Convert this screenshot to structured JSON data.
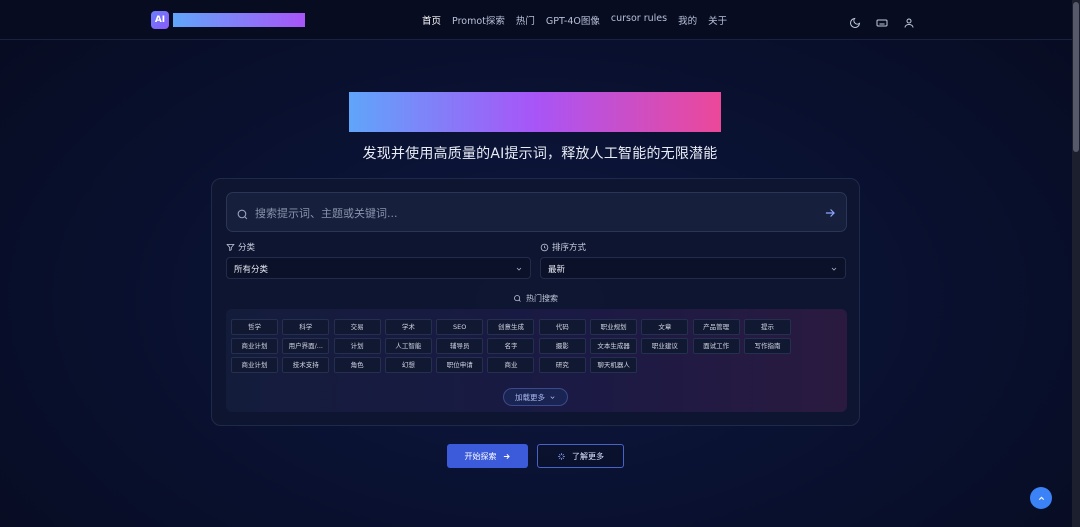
{
  "header": {
    "logo_text": "AI",
    "nav": [
      "首页",
      "Promot探索",
      "热门",
      "GPT-4O图像",
      "cursor rules",
      "我的",
      "关于"
    ],
    "icons": [
      "moon-icon",
      "keyboard-icon",
      "user-icon"
    ]
  },
  "hero": {
    "subtitle": "发现并使用高质量的AI提示词，释放人工智能的无限潜能"
  },
  "search": {
    "placeholder": "搜索提示词、主题或关键词..."
  },
  "filters": {
    "category_label": "分类",
    "category_value": "所有分类",
    "sort_label": "排序方式",
    "sort_value": "最新"
  },
  "hot": {
    "title": "热门搜索",
    "tags": [
      "哲学",
      "科学",
      "交易",
      "学术",
      "SEO",
      "创意生成",
      "代码",
      "职业规划",
      "文章",
      "产品管理",
      "提示",
      "商业计划",
      "用户界面/...",
      "计划",
      "人工智能",
      "辅导员",
      "名字",
      "摄影",
      "文本生成器",
      "职业建议",
      "面试工作",
      "写作指南",
      "商业计划",
      "技术支持",
      "角色",
      "幻想",
      "职位申请",
      "商业",
      "研究",
      "聊天机器人"
    ],
    "load_more": "加载更多"
  },
  "cta": {
    "primary": "开始探索",
    "secondary": "了解更多"
  },
  "colors": {
    "accent": "#3b5bdb",
    "hero_gradient": [
      "#60a5fa",
      "#a855f7",
      "#ec4899"
    ]
  }
}
